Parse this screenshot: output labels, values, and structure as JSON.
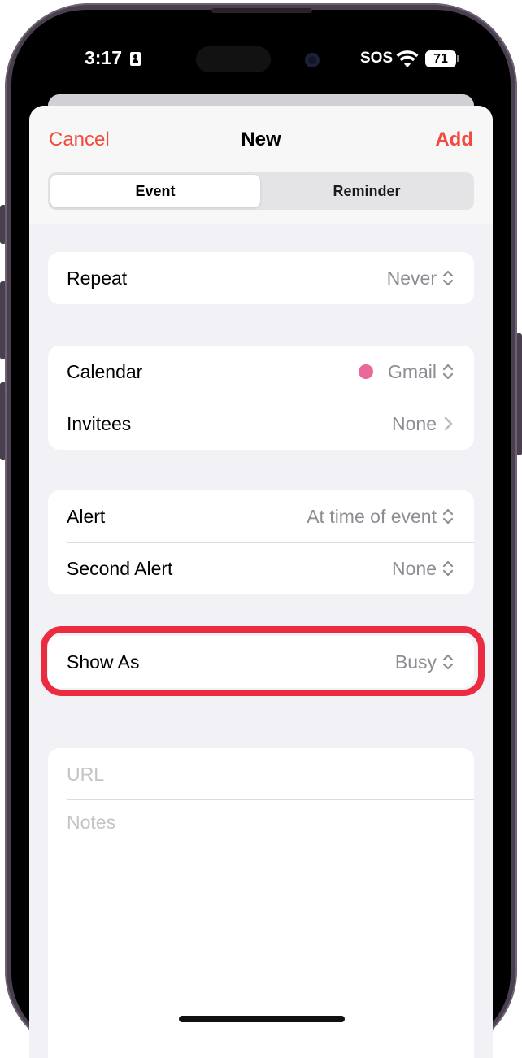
{
  "status_bar": {
    "time": "3:17",
    "sos": "SOS",
    "battery": "71"
  },
  "nav": {
    "cancel_label": "Cancel",
    "title": "New",
    "add_label": "Add",
    "accent_color": "#f4493c"
  },
  "segments": {
    "event_label": "Event",
    "reminder_label": "Reminder",
    "selected": "Event"
  },
  "repeat": {
    "label": "Repeat",
    "value": "Never"
  },
  "calendar": {
    "label": "Calendar",
    "value": "Gmail",
    "dot_color": "#e96a9a"
  },
  "invitees": {
    "label": "Invitees",
    "value": "None"
  },
  "alert": {
    "label": "Alert",
    "value": "At time of event"
  },
  "second_alert": {
    "label": "Second Alert",
    "value": "None"
  },
  "show_as": {
    "label": "Show As",
    "value": "Busy",
    "highlight_color": "#ea2b40"
  },
  "url_field": {
    "placeholder": "URL"
  },
  "notes_field": {
    "placeholder": "Notes"
  }
}
